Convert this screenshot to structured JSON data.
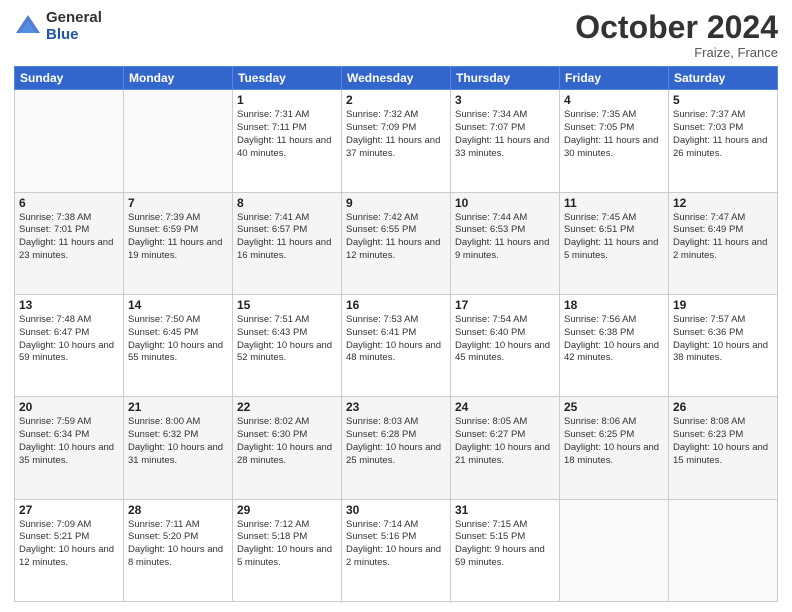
{
  "logo": {
    "general": "General",
    "blue": "Blue"
  },
  "header": {
    "month": "October 2024",
    "location": "Fraize, France"
  },
  "days_of_week": [
    "Sunday",
    "Monday",
    "Tuesday",
    "Wednesday",
    "Thursday",
    "Friday",
    "Saturday"
  ],
  "weeks": [
    [
      {
        "day": "",
        "info": ""
      },
      {
        "day": "",
        "info": ""
      },
      {
        "day": "1",
        "info": "Sunrise: 7:31 AM\nSunset: 7:11 PM\nDaylight: 11 hours and 40 minutes."
      },
      {
        "day": "2",
        "info": "Sunrise: 7:32 AM\nSunset: 7:09 PM\nDaylight: 11 hours and 37 minutes."
      },
      {
        "day": "3",
        "info": "Sunrise: 7:34 AM\nSunset: 7:07 PM\nDaylight: 11 hours and 33 minutes."
      },
      {
        "day": "4",
        "info": "Sunrise: 7:35 AM\nSunset: 7:05 PM\nDaylight: 11 hours and 30 minutes."
      },
      {
        "day": "5",
        "info": "Sunrise: 7:37 AM\nSunset: 7:03 PM\nDaylight: 11 hours and 26 minutes."
      }
    ],
    [
      {
        "day": "6",
        "info": "Sunrise: 7:38 AM\nSunset: 7:01 PM\nDaylight: 11 hours and 23 minutes."
      },
      {
        "day": "7",
        "info": "Sunrise: 7:39 AM\nSunset: 6:59 PM\nDaylight: 11 hours and 19 minutes."
      },
      {
        "day": "8",
        "info": "Sunrise: 7:41 AM\nSunset: 6:57 PM\nDaylight: 11 hours and 16 minutes."
      },
      {
        "day": "9",
        "info": "Sunrise: 7:42 AM\nSunset: 6:55 PM\nDaylight: 11 hours and 12 minutes."
      },
      {
        "day": "10",
        "info": "Sunrise: 7:44 AM\nSunset: 6:53 PM\nDaylight: 11 hours and 9 minutes."
      },
      {
        "day": "11",
        "info": "Sunrise: 7:45 AM\nSunset: 6:51 PM\nDaylight: 11 hours and 5 minutes."
      },
      {
        "day": "12",
        "info": "Sunrise: 7:47 AM\nSunset: 6:49 PM\nDaylight: 11 hours and 2 minutes."
      }
    ],
    [
      {
        "day": "13",
        "info": "Sunrise: 7:48 AM\nSunset: 6:47 PM\nDaylight: 10 hours and 59 minutes."
      },
      {
        "day": "14",
        "info": "Sunrise: 7:50 AM\nSunset: 6:45 PM\nDaylight: 10 hours and 55 minutes."
      },
      {
        "day": "15",
        "info": "Sunrise: 7:51 AM\nSunset: 6:43 PM\nDaylight: 10 hours and 52 minutes."
      },
      {
        "day": "16",
        "info": "Sunrise: 7:53 AM\nSunset: 6:41 PM\nDaylight: 10 hours and 48 minutes."
      },
      {
        "day": "17",
        "info": "Sunrise: 7:54 AM\nSunset: 6:40 PM\nDaylight: 10 hours and 45 minutes."
      },
      {
        "day": "18",
        "info": "Sunrise: 7:56 AM\nSunset: 6:38 PM\nDaylight: 10 hours and 42 minutes."
      },
      {
        "day": "19",
        "info": "Sunrise: 7:57 AM\nSunset: 6:36 PM\nDaylight: 10 hours and 38 minutes."
      }
    ],
    [
      {
        "day": "20",
        "info": "Sunrise: 7:59 AM\nSunset: 6:34 PM\nDaylight: 10 hours and 35 minutes."
      },
      {
        "day": "21",
        "info": "Sunrise: 8:00 AM\nSunset: 6:32 PM\nDaylight: 10 hours and 31 minutes."
      },
      {
        "day": "22",
        "info": "Sunrise: 8:02 AM\nSunset: 6:30 PM\nDaylight: 10 hours and 28 minutes."
      },
      {
        "day": "23",
        "info": "Sunrise: 8:03 AM\nSunset: 6:28 PM\nDaylight: 10 hours and 25 minutes."
      },
      {
        "day": "24",
        "info": "Sunrise: 8:05 AM\nSunset: 6:27 PM\nDaylight: 10 hours and 21 minutes."
      },
      {
        "day": "25",
        "info": "Sunrise: 8:06 AM\nSunset: 6:25 PM\nDaylight: 10 hours and 18 minutes."
      },
      {
        "day": "26",
        "info": "Sunrise: 8:08 AM\nSunset: 6:23 PM\nDaylight: 10 hours and 15 minutes."
      }
    ],
    [
      {
        "day": "27",
        "info": "Sunrise: 7:09 AM\nSunset: 5:21 PM\nDaylight: 10 hours and 12 minutes."
      },
      {
        "day": "28",
        "info": "Sunrise: 7:11 AM\nSunset: 5:20 PM\nDaylight: 10 hours and 8 minutes."
      },
      {
        "day": "29",
        "info": "Sunrise: 7:12 AM\nSunset: 5:18 PM\nDaylight: 10 hours and 5 minutes."
      },
      {
        "day": "30",
        "info": "Sunrise: 7:14 AM\nSunset: 5:16 PM\nDaylight: 10 hours and 2 minutes."
      },
      {
        "day": "31",
        "info": "Sunrise: 7:15 AM\nSunset: 5:15 PM\nDaylight: 9 hours and 59 minutes."
      },
      {
        "day": "",
        "info": ""
      },
      {
        "day": "",
        "info": ""
      }
    ]
  ]
}
